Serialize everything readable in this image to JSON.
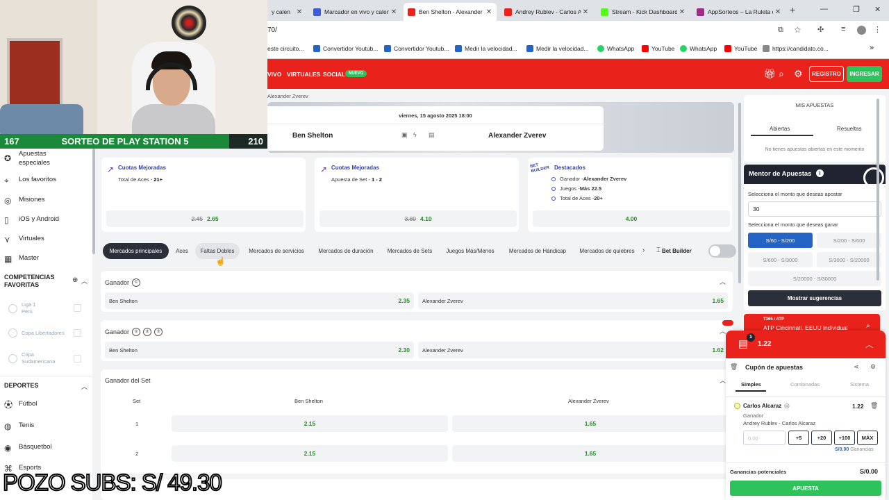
{
  "browser": {
    "tabs": [
      {
        "label": "y calen",
        "color": "#ffffff"
      },
      {
        "label": "Marcador en vivo y calend",
        "color": "#3b5bdb"
      },
      {
        "label": "Ben Shelton - Alexander Z",
        "color": "#e9221b"
      },
      {
        "label": "Andrey Rublev - Carlos Alc",
        "color": "#e9221b"
      },
      {
        "label": "Stream - Kick Dashboard",
        "color": "#53fc18"
      },
      {
        "label": "AppSorteos – La Ruleta de",
        "color": "#a02a8a"
      }
    ],
    "new_tab": "+",
    "url": "70/",
    "bookmarks": [
      {
        "label": "este circuito...",
        "color": "#ffffff"
      },
      {
        "label": "Convertidor Youtub...",
        "color": "#2464c4"
      },
      {
        "label": "Convertidor Youtub...",
        "color": "#2464c4"
      },
      {
        "label": "Medir la velocidad...",
        "color": "#2464c4"
      },
      {
        "label": "Medir la velocidad...",
        "color": "#2464c4"
      },
      {
        "label": "WhatsApp",
        "color": "#25d366"
      },
      {
        "label": "YouTube",
        "color": "#ff0000"
      },
      {
        "label": "WhatsApp",
        "color": "#25d366"
      },
      {
        "label": "YouTube",
        "color": "#ff0000"
      },
      {
        "label": "https://candidato.co...",
        "color": "#888888"
      }
    ],
    "more": "»"
  },
  "header": {
    "nav": [
      "VIVO",
      "VIRTUALES",
      "SOCIAL"
    ],
    "nuevo_badge": "NUEVO",
    "registro": "REGISTRO",
    "ingresar": "INGRESAR"
  },
  "sidebar": {
    "items": [
      {
        "label": "Apuestas especiales",
        "icon": "star-shield-icon"
      },
      {
        "label": "Los favoritos",
        "icon": "location-icon"
      },
      {
        "label": "Misiones",
        "icon": "target-icon"
      },
      {
        "label": "iOS y Android",
        "icon": "phone-icon"
      },
      {
        "label": "Virtuales",
        "icon": "virtual-icon"
      },
      {
        "label": "Master",
        "icon": "master-icon"
      }
    ],
    "competencias_title": "COMPETENCIAS FAVORITAS",
    "competencias": [
      {
        "name": "Liga 1",
        "sub": "Perú"
      },
      {
        "name": "Copa Libertadores",
        "sub": ""
      },
      {
        "name": "Copa Sudamericana",
        "sub": ""
      }
    ],
    "deportes_title": "DEPORTES",
    "deportes": [
      "Fútbol",
      "Tenis",
      "Básquetbol",
      "Esports"
    ]
  },
  "match": {
    "breadcrumb": "Alexander Zverev",
    "date": "viernes, 15 agosto 2025 18:00",
    "home": "Ben Shelton",
    "away": "Alexander Zverev"
  },
  "promos": [
    {
      "title": "Cuotas Mejoradas",
      "line_label": "Total de Aces - ",
      "line_value": "21+",
      "old": "2.45",
      "new": "2.65"
    },
    {
      "title": "Cuotas Mejoradas",
      "line_label": "Apuesta de Set - ",
      "line_value": "1 - 2",
      "old": "3.80",
      "new": "4.10"
    },
    {
      "title": "Destacados",
      "badge": "BET BUILDER",
      "lines": [
        {
          "label": "Ganador - ",
          "value": "Alexander Zverev"
        },
        {
          "label": "Juegos - ",
          "value": "Más 22.5"
        },
        {
          "label": "Total de Aces - ",
          "value": "20+"
        }
      ],
      "new": "4.00"
    }
  ],
  "market_tabs": [
    "Mercados principales",
    "Aces",
    "Faltas Dobles",
    "Mercados de servicios",
    "Mercados de duración",
    "Mercados de Sets",
    "Juegos Más/Menos",
    "Mercados de Hándicap",
    "Mercados de quiebres"
  ],
  "bet_builder_label": "Bet Builder",
  "markets": {
    "ganador1": {
      "title": "Ganador",
      "home": "Ben Shelton",
      "home_odd": "2.35",
      "away": "Alexander Zverev",
      "away_odd": "1.65"
    },
    "ganador2": {
      "title": "Ganador",
      "home": "Ben Shelton",
      "home_odd": "2.30",
      "away": "Alexander Zverev",
      "away_odd": "1.62"
    },
    "ganador_set": {
      "title": "Ganador del Set",
      "col_set": "Set",
      "col_home": "Ben Shelton",
      "col_away": "Alexander Zverev",
      "rows": [
        {
          "set": "1",
          "home": "2.15",
          "away": "1.65"
        },
        {
          "set": "2",
          "home": "2.15",
          "away": "1.65"
        }
      ]
    }
  },
  "mis_apuestas": {
    "title": "MIS APUESTAS",
    "tab_open": "Abiertas",
    "tab_results": "Resueltas",
    "empty": "No tienes apuestas abiertas en este momento"
  },
  "mentor": {
    "title": "Mentor de Apuestas",
    "label_amount": "Selecciona el monto que deseas apostar",
    "amount": "30",
    "label_win": "Selecciona el monto que deseas ganar",
    "ranges": [
      "S/60 - S/200",
      "S/200 - S/600",
      "S/600 - S/3000",
      "S/3000 - S/20000",
      "S/20000 - S/30000"
    ],
    "suggest": "Mostrar sugerencias"
  },
  "atp": {
    "small": "T365 / ATP",
    "label": "ATP Cincinnati. EEUU individual"
  },
  "coupon": {
    "count": "1",
    "odds": "1.22",
    "title": "Cupón de apuestas",
    "tabs": [
      "Simples",
      "Combinadas",
      "Sistema"
    ],
    "bet": {
      "player": "Carlos Alcaraz",
      "odd": "1.22",
      "market": "Ganador",
      "match": "Andrey Rublev - Carlos Alcaraz",
      "placeholder": "0.00",
      "quick": [
        "+5",
        "+20",
        "+100",
        "MÁX"
      ],
      "gan_value": "S/0.00",
      "gan_label": "Ganancias"
    },
    "potential_label": "Ganancias potenciales",
    "potential_value": "S/0.00",
    "submit": "APUESTA"
  },
  "stream": {
    "left_count": "167",
    "title": "SORTEO DE PLAY STATION 5",
    "right_count": "210",
    "pozo": "POZO SUBS: S/ 49.30"
  },
  "colors": {
    "brand_red": "#e9221b",
    "green": "#2ec35a",
    "odd_green": "#2a8a2a",
    "dark": "#2b2f3a",
    "blue": "#2464c4"
  }
}
